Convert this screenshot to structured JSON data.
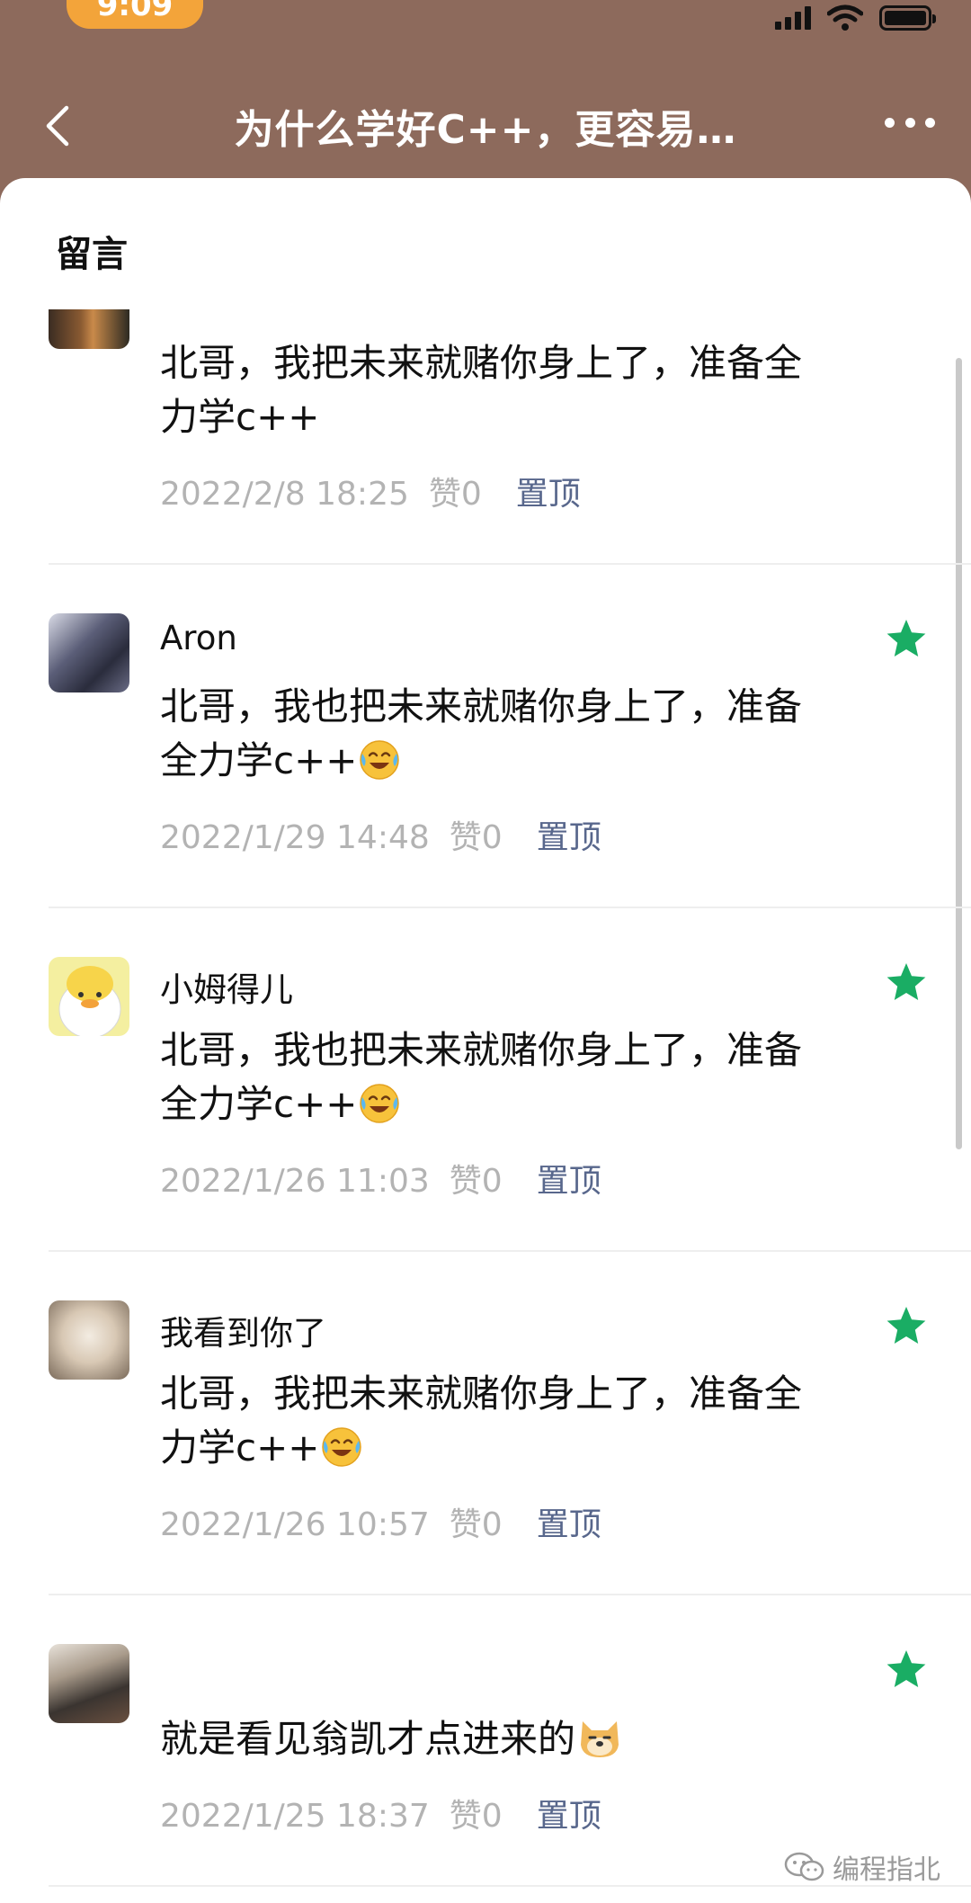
{
  "status": {
    "time": "9:09"
  },
  "nav": {
    "title": "为什么学好C++，更容易…"
  },
  "section": {
    "title": "留言"
  },
  "comments": [
    {
      "name": "",
      "text": "北哥，我把未来就赌你身上了，准备全力学c++",
      "date": "2022/2/8 18:25",
      "likes": "赞0",
      "pin": "置顶",
      "starred": false
    },
    {
      "name": "Aron",
      "text": "北哥，我也把未来就赌你身上了，准备全力学c++",
      "emoji": "laugh-cry-emoji",
      "date": "2022/1/29 14:48",
      "likes": "赞0",
      "pin": "置顶",
      "starred": true
    },
    {
      "name": "小姆得儿",
      "text": "北哥，我也把未来就赌你身上了，准备全力学c++",
      "emoji": "laugh-cry-emoji",
      "date": "2022/1/26 11:03",
      "likes": "赞0",
      "pin": "置顶",
      "starred": true
    },
    {
      "name": "我看到你了",
      "text": "北哥，我把未来就赌你身上了，准备全力学c++",
      "emoji": "laugh-cry-emoji",
      "date": "2022/1/26 10:57",
      "likes": "赞0",
      "pin": "置顶",
      "starred": true
    },
    {
      "name": "",
      "text": "就是看见翁凯才点进来的",
      "emoji": "doge-emoji",
      "date": "2022/1/25 18:37",
      "likes": "赞0",
      "pin": "置顶",
      "starred": true
    }
  ],
  "watermark": "编程指北",
  "colors": {
    "header_bg": "#8d6a5c",
    "accent_green": "#1aad64",
    "pin_link": "#58678c",
    "meta_gray": "#b3b3b3",
    "time_pill": "#f3a43a"
  }
}
